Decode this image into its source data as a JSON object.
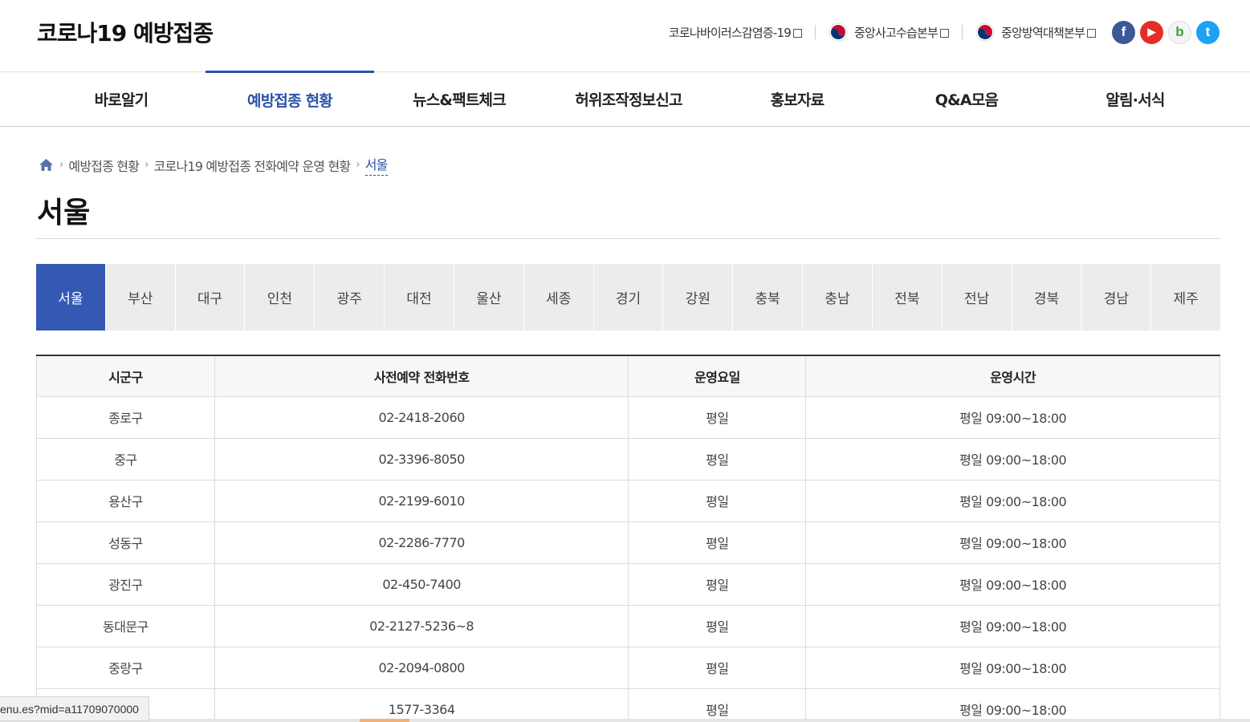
{
  "header": {
    "logo": "코로나19 예방접종",
    "links": [
      {
        "label": "코로나바이러스감염증-19"
      },
      {
        "label": "중앙사고수습본부"
      },
      {
        "label": "중앙방역대책본부"
      }
    ],
    "social": [
      "facebook-icon",
      "youtube-icon",
      "blog-icon",
      "twitter-icon"
    ],
    "social_glyphs": {
      "facebook": "f",
      "youtube": "▶",
      "blog": "b",
      "twitter": "t"
    }
  },
  "nav": {
    "items": [
      "바로알기",
      "예방접종 현황",
      "뉴스&팩트체크",
      "허위조작정보신고",
      "홍보자료",
      "Q&A모음",
      "알림·서식"
    ],
    "active_index": 1
  },
  "breadcrumb": {
    "items": [
      "예방접종 현황",
      "코로나19 예방접종 전화예약 운영 현황"
    ],
    "current": "서울"
  },
  "page_title": "서울",
  "regions": [
    "서울",
    "부산",
    "대구",
    "인천",
    "광주",
    "대전",
    "울산",
    "세종",
    "경기",
    "강원",
    "충북",
    "충남",
    "전북",
    "전남",
    "경북",
    "경남",
    "제주"
  ],
  "active_region": "서울",
  "table": {
    "headers": [
      "시군구",
      "사전예약 전화번호",
      "운영요일",
      "운영시간"
    ],
    "rows": [
      [
        "종로구",
        "02-2418-2060",
        "평일",
        "평일 09:00~18:00"
      ],
      [
        "중구",
        "02-3396-8050",
        "평일",
        "평일 09:00~18:00"
      ],
      [
        "용산구",
        "02-2199-6010",
        "평일",
        "평일 09:00~18:00"
      ],
      [
        "성동구",
        "02-2286-7770",
        "평일",
        "평일 09:00~18:00"
      ],
      [
        "광진구",
        "02-450-7400",
        "평일",
        "평일 09:00~18:00"
      ],
      [
        "동대문구",
        "02-2127-5236~8",
        "평일",
        "평일 09:00~18:00"
      ],
      [
        "중랑구",
        "02-2094-0800",
        "평일",
        "평일 09:00~18:00"
      ],
      [
        "",
        "1577-3364",
        "평일",
        "평일 09:00~18:00"
      ]
    ]
  },
  "status_bar": "enu.es?mid=a11709070000",
  "colors": {
    "accent": "#2a52a8",
    "tab_active": "#3559b3",
    "facebook": "#3b5998",
    "youtube": "#e52d27",
    "twitter": "#1da1f2",
    "blog": "#f4f4f4"
  }
}
